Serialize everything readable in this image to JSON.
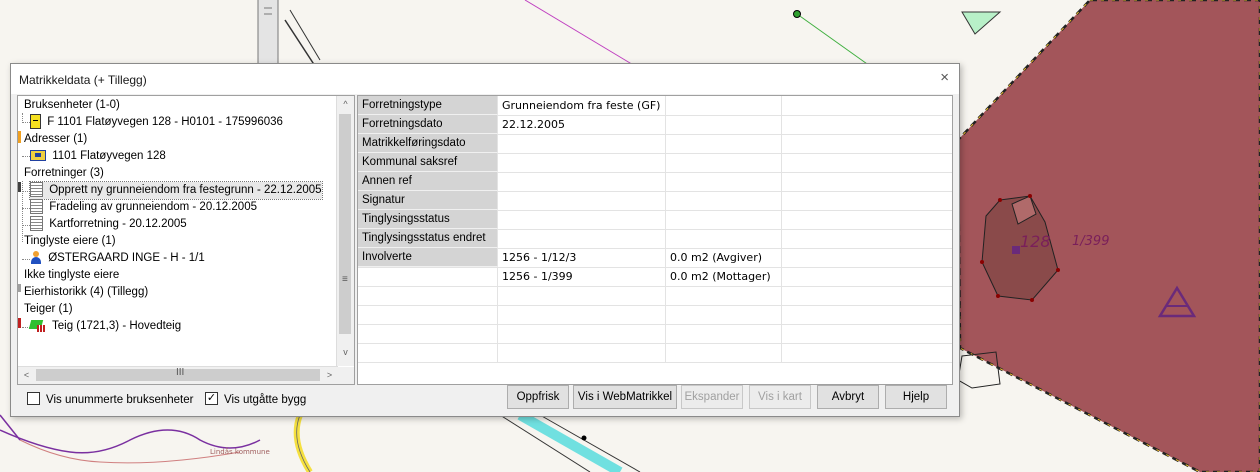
{
  "dialog": {
    "title": "Matrikkeldata (+ Tillegg)"
  },
  "tree": {
    "items": [
      {
        "label": "Bruksenheter (1-0)"
      },
      {
        "label": "F 1101 Flatøyvegen 128 - H0101 - 175996036"
      },
      {
        "label": "Adresser (1)"
      },
      {
        "label": "1101 Flatøyvegen 128"
      },
      {
        "label": "Forretninger (3)"
      },
      {
        "label": "Opprett ny grunneiendom fra festegrunn - 22.12.2005"
      },
      {
        "label": "Fradeling av grunneiendom - 20.12.2005"
      },
      {
        "label": "Kartforretning - 20.12.2005"
      },
      {
        "label": "Tinglyste eiere (1)"
      },
      {
        "label": "ØSTERGAARD INGE - H - 1/1"
      },
      {
        "label": "Ikke tinglyste eiere"
      },
      {
        "label": "Eierhistorikk (4) (Tillegg)"
      },
      {
        "label": "Teiger (1)"
      },
      {
        "label": "Teig (1721,3) - Hovedteig"
      }
    ],
    "scroll_grip": "≡",
    "hscroll_grip": "III",
    "arrow_up": "^",
    "arrow_down": "v",
    "arrow_left": "<",
    "arrow_right": ">"
  },
  "grid": {
    "rows": [
      {
        "label": "Forretningstype",
        "v1": "Grunneiendom fra feste (GF)",
        "v2": "",
        "v3": ""
      },
      {
        "label": "Forretningsdato",
        "v1": "22.12.2005",
        "v2": "",
        "v3": ""
      },
      {
        "label": "Matrikkelføringsdato",
        "v1": "",
        "v2": "",
        "v3": ""
      },
      {
        "label": "Kommunal saksref",
        "v1": "",
        "v2": "",
        "v3": ""
      },
      {
        "label": "Annen ref",
        "v1": "",
        "v2": "",
        "v3": ""
      },
      {
        "label": "Signatur",
        "v1": "",
        "v2": "",
        "v3": ""
      },
      {
        "label": "Tinglysingsstatus",
        "v1": "",
        "v2": "",
        "v3": ""
      },
      {
        "label": "Tinglysingsstatus endret",
        "v1": "",
        "v2": "",
        "v3": ""
      },
      {
        "label": "Involverte",
        "v1": "1256 - 1/12/3",
        "v2": "0.0 m2 (Avgiver)",
        "v3": ""
      },
      {
        "label": "",
        "v1": "1256 - 1/399",
        "v2": "0.0 m2 (Mottager)",
        "v3": ""
      },
      {
        "label": "",
        "v1": "",
        "v2": "",
        "v3": ""
      },
      {
        "label": "",
        "v1": "",
        "v2": "",
        "v3": ""
      },
      {
        "label": "",
        "v1": "",
        "v2": "",
        "v3": ""
      },
      {
        "label": "",
        "v1": "",
        "v2": "",
        "v3": ""
      }
    ]
  },
  "options": {
    "show_unnumbered": "Vis unummerte bruksenheter",
    "show_expired": "Vis utgåtte bygg",
    "show_expired_checked": "✓"
  },
  "buttons": {
    "refresh": "Oppfrisk",
    "webmatrikkel": "Vis i WebMatrikkel",
    "expand": "Ekspander",
    "show_map": "Vis i kart",
    "cancel": "Avbryt",
    "help": "Hjelp"
  },
  "map": {
    "parcel_label": "128",
    "neighbor_label": "1/399",
    "place_label": "Lindås kommune"
  },
  "colors": {
    "parcel_fill": "#a3555a",
    "parcel_border": "#f0c030",
    "accent_purple": "#6a2a7a"
  }
}
